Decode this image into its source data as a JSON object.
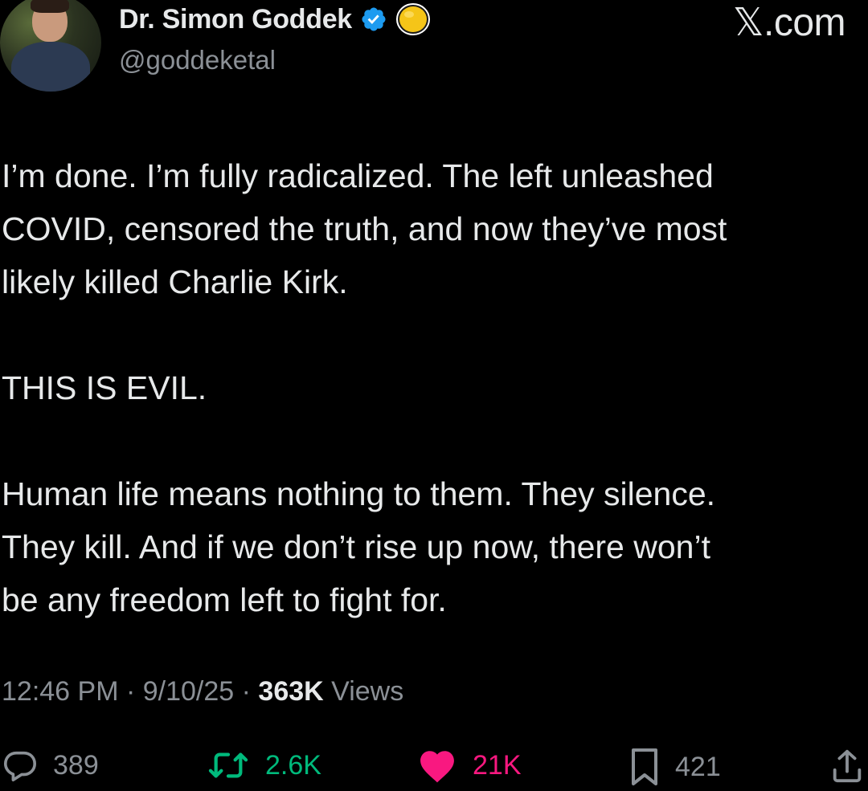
{
  "author": {
    "display_name": "Dr. Simon Goddek",
    "handle": "@goddeketal",
    "verified": true,
    "badge_emoji": "yellow-circle-icon"
  },
  "brand": "𝕏.com",
  "tweet": {
    "paragraphs": [
      "I’m done. I’m fully radicalized. The left unleashed\nCOVID, censored the truth, and now they’ve most\nlikely killed Charlie Kirk.",
      "THIS IS EVIL.",
      "Human life means nothing to them. They silence.\nThey kill. And if we don’t rise up now, there won’t\nbe any freedom left to fight for."
    ]
  },
  "meta": {
    "time": "12:46 PM",
    "separator": " · ",
    "date": "9/10/25",
    "views_count": "363K",
    "views_label": " Views"
  },
  "actions": {
    "replies": "389",
    "reposts": "2.6K",
    "likes": "21K",
    "bookmarks": "421"
  },
  "colors": {
    "background": "#000000",
    "text": "#e7e9ea",
    "muted": "#8b9096",
    "like": "#f91880",
    "repost": "#00ba7c",
    "verified": "#1d9bf0"
  }
}
